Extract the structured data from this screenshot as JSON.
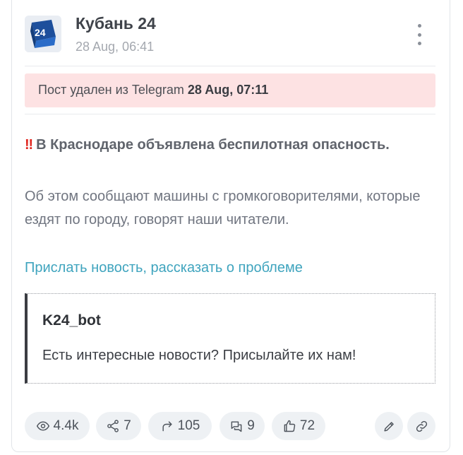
{
  "post": {
    "channel_name": "Кубань 24",
    "avatar_text": "24",
    "time": "28 Aug, 06:41"
  },
  "deleted_banner": {
    "text": "Пост удален из Telegram",
    "date": "28 Aug, 07:11"
  },
  "message": {
    "headline_emoji": "‼",
    "headline": "В Краснодаре объявлена беспилотная опасность.",
    "body": "Об этом сообщают машины с громкоговорителями, которые ездят по городу, говорят наши читатели.",
    "link_text": "Прислать новость, рассказать о проблеме"
  },
  "quote": {
    "author": "K24_bot",
    "text": "Есть интересные новости? Присылайте их нам!"
  },
  "stats": {
    "views": "4.4k",
    "shares": "7",
    "forwards": "105",
    "comments": "9",
    "likes": "72"
  },
  "icons": [
    "eye-icon",
    "share-icon",
    "forward-icon",
    "comment-icon",
    "thumbs-up-icon",
    "pencil-icon",
    "link-icon",
    "more-icon"
  ],
  "colors": {
    "banner_bg": "#fde2e3",
    "link": "#3fa4be",
    "alert_emoji": "#e0261f",
    "pill_bg": "#eef1f4"
  }
}
